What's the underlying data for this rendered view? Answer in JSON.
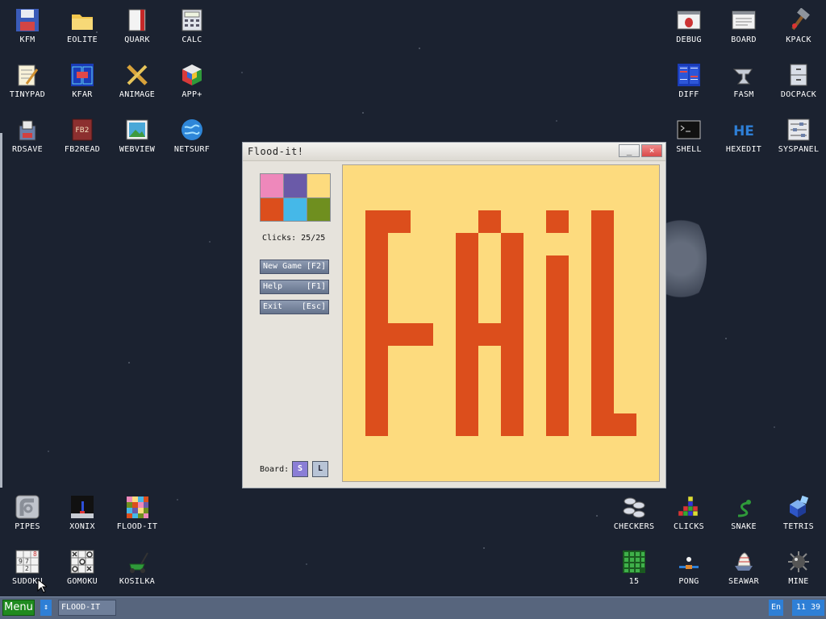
{
  "desktop": {
    "icons": [
      {
        "label": "KFM",
        "icon": "floppy-disk-icon"
      },
      {
        "label": "EOLITE",
        "icon": "folder-icon"
      },
      {
        "label": "QUARK",
        "icon": "notebook-icon"
      },
      {
        "label": "CALC",
        "icon": "calculator-icon"
      },
      {
        "label": "TINYPAD",
        "icon": "notepad-icon"
      },
      {
        "label": "KFAR",
        "icon": "dual-panel-icon"
      },
      {
        "label": "ANIMAGE",
        "icon": "pencil-ruler-icon"
      },
      {
        "label": "APP+",
        "icon": "rubik-cube-icon"
      },
      {
        "label": "RDSAVE",
        "icon": "save-disk-icon"
      },
      {
        "label": "FB2READ",
        "icon": "book-icon"
      },
      {
        "label": "WEBVIEW",
        "icon": "web-picture-icon"
      },
      {
        "label": "NETSURF",
        "icon": "globe-icon"
      },
      {
        "label": "DEBUG",
        "icon": "bug-window-icon"
      },
      {
        "label": "BOARD",
        "icon": "board-window-icon"
      },
      {
        "label": "KPACK",
        "icon": "hammer-icon"
      },
      {
        "label": "DIFF",
        "icon": "diff-icon"
      },
      {
        "label": "FASM",
        "icon": "anvil-icon"
      },
      {
        "label": "DOCPACK",
        "icon": "cabinet-icon"
      },
      {
        "label": "SHELL",
        "icon": "terminal-icon"
      },
      {
        "label": "HEXEDIT",
        "icon": "hex-icon"
      },
      {
        "label": "SYSPANEL",
        "icon": "sliders-icon"
      },
      {
        "label": "PIPES",
        "icon": "pipes-icon"
      },
      {
        "label": "XONIX",
        "icon": "xonix-icon"
      },
      {
        "label": "FLOOD-IT",
        "icon": "color-grid-icon"
      },
      {
        "label": "SUDOKU",
        "icon": "sudoku-icon"
      },
      {
        "label": "GOMOKU",
        "icon": "tic-tac-icon"
      },
      {
        "label": "KOSILKA",
        "icon": "lawnmower-icon"
      },
      {
        "label": "CHECKERS",
        "icon": "checkers-icon"
      },
      {
        "label": "CLICKS",
        "icon": "blocks-icon"
      },
      {
        "label": "SNAKE",
        "icon": "snake-icon"
      },
      {
        "label": "TETRIS",
        "icon": "tetris-icon"
      },
      {
        "label": "15",
        "icon": "green-grid-icon"
      },
      {
        "label": "PONG",
        "icon": "pong-icon"
      },
      {
        "label": "SEAWAR",
        "icon": "ship-icon"
      },
      {
        "label": "MINE",
        "icon": "mine-icon"
      }
    ]
  },
  "window": {
    "title": "Flood-it!",
    "minimize_glyph": "_",
    "close_glyph": "×",
    "palette": [
      "#ee88bb",
      "#6a5aa8",
      "#fddb7e",
      "#dc4e1c",
      "#45b8e8",
      "#6f8f1f"
    ],
    "clicks_text": "Clicks: 25/25",
    "buttons": {
      "new_game": {
        "label": "New Game",
        "key": "[F2]"
      },
      "help": {
        "label": "Help",
        "key": "[F1]"
      },
      "exit": {
        "label": "Exit",
        "key": "[Esc]"
      }
    },
    "board_label": "Board:",
    "board_small": "S",
    "board_large": "L",
    "result_text": "FAiL",
    "result_colors": {
      "background": "#fddb7e",
      "text": "#dc4e1c"
    }
  },
  "taskbar": {
    "menu_label": "Menu",
    "switch_glyph": "↕",
    "task_item": "FLOOD-IT",
    "lang": "En",
    "clock": "11 39"
  }
}
